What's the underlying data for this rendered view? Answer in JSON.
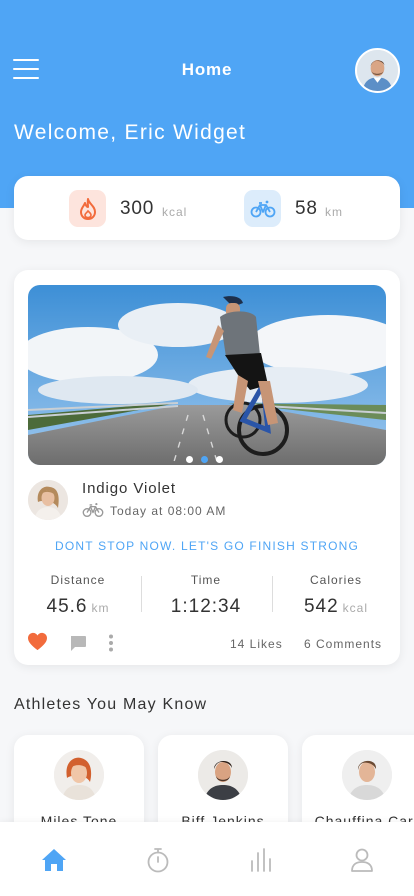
{
  "header": {
    "title": "Home",
    "welcome": "Welcome, Eric Widget",
    "accent": "#4fa5f5"
  },
  "stats": {
    "calories": {
      "value": "300",
      "unit": "kcal",
      "icon": "flame-icon"
    },
    "distance": {
      "value": "58",
      "unit": "km",
      "icon": "bicycle-icon"
    }
  },
  "post": {
    "carousel": {
      "count": 3,
      "active_index": 1
    },
    "author": "Indigo Violet",
    "time": "Today at 08:00 AM",
    "motto": "DONT STOP NOW. LET'S GO FINISH STRONG",
    "metrics": [
      {
        "label": "Distance",
        "value": "45.6",
        "unit": "km"
      },
      {
        "label": "Time",
        "value": "1:12:34",
        "unit": ""
      },
      {
        "label": "Calories",
        "value": "542",
        "unit": "kcal"
      }
    ],
    "likes": "14 Likes",
    "comments": "6 Comments"
  },
  "athletes": {
    "title": "Athletes You May Know",
    "items": [
      {
        "name": "Miles Tone"
      },
      {
        "name": "Biff Jenkins"
      },
      {
        "name": "Chauffina Carr"
      }
    ]
  },
  "nav": {
    "items": [
      "home-icon",
      "stopwatch-icon",
      "chart-icon",
      "profile-icon"
    ],
    "active": "home-icon"
  }
}
